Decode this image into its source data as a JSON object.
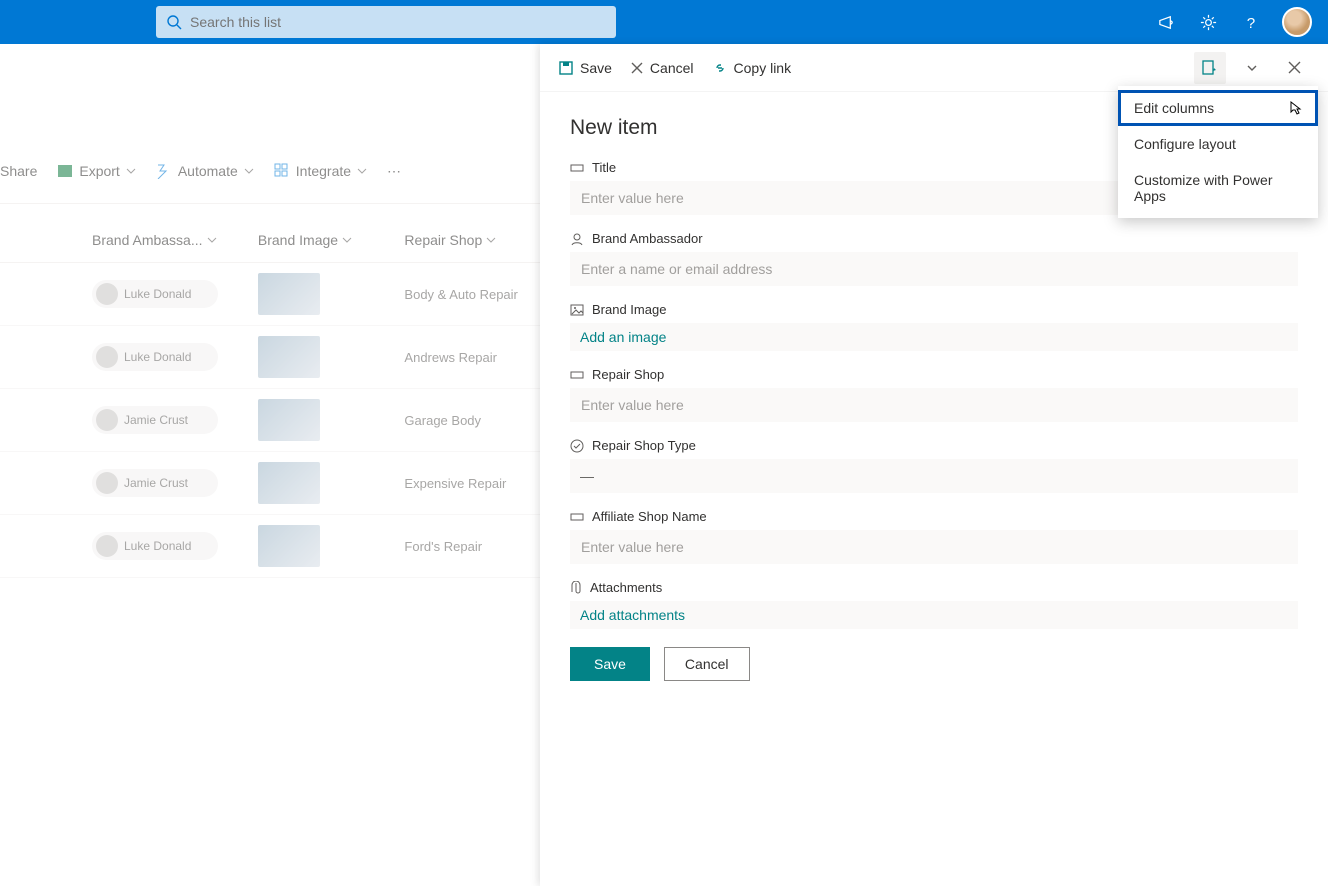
{
  "topbar": {
    "search_placeholder": "Search this list"
  },
  "commandbar": {
    "share": "Share",
    "export": "Export",
    "automate": "Automate",
    "integrate": "Integrate"
  },
  "list": {
    "headers": {
      "brand_ambassador": "Brand Ambassa...",
      "brand_image": "Brand Image",
      "repair_shop": "Repair Shop"
    },
    "rows": [
      {
        "person": "Luke Donald",
        "repair": "Body & Auto Repair"
      },
      {
        "person": "Luke Donald",
        "repair": "Andrews Repair"
      },
      {
        "person": "Jamie Crust",
        "repair": "Garage Body"
      },
      {
        "person": "Jamie Crust",
        "repair": "Expensive Repair"
      },
      {
        "person": "Luke Donald",
        "repair": "Ford's Repair"
      }
    ]
  },
  "panel": {
    "cmd_save": "Save",
    "cmd_cancel": "Cancel",
    "cmd_copylink": "Copy link",
    "title": "New item",
    "fields": {
      "title_label": "Title",
      "title_placeholder": "Enter value here",
      "ambassador_label": "Brand Ambassador",
      "ambassador_placeholder": "Enter a name or email address",
      "image_label": "Brand Image",
      "image_action": "Add an image",
      "repair_label": "Repair Shop",
      "repair_placeholder": "Enter value here",
      "repairtype_label": "Repair Shop Type",
      "repairtype_value": "—",
      "affiliate_label": "Affiliate Shop Name",
      "affiliate_placeholder": "Enter value here",
      "attachments_label": "Attachments",
      "attachments_action": "Add attachments"
    },
    "save_btn": "Save",
    "cancel_btn": "Cancel"
  },
  "menu": {
    "edit_columns": "Edit columns",
    "configure_layout": "Configure layout",
    "customize": "Customize with Power Apps"
  }
}
